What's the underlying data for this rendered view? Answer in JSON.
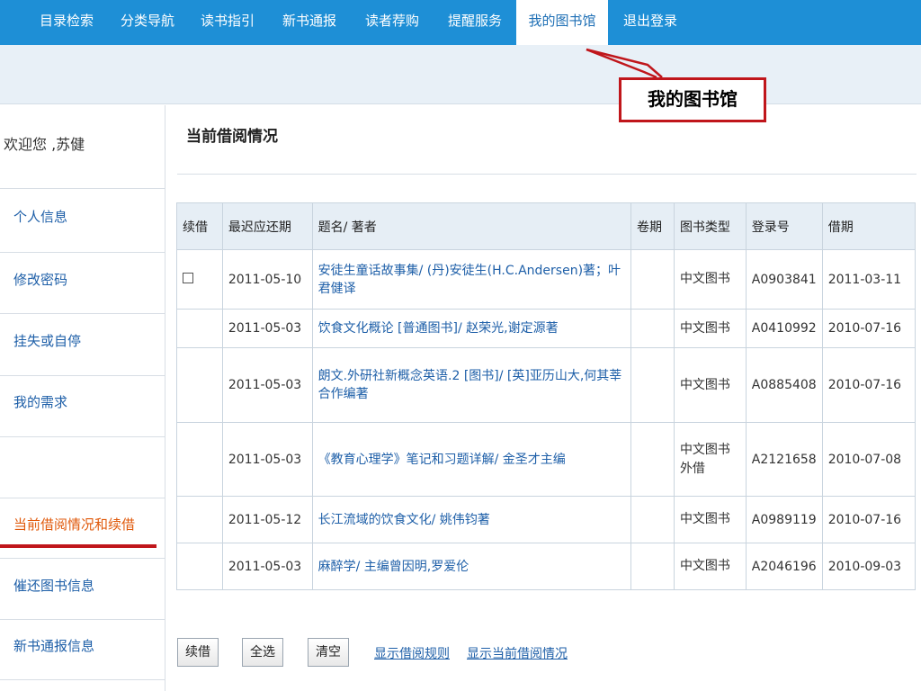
{
  "nav": {
    "items": [
      {
        "label": "目录检索"
      },
      {
        "label": "分类导航"
      },
      {
        "label": "读书指引"
      },
      {
        "label": "新书通报"
      },
      {
        "label": "读者荐购"
      },
      {
        "label": "提醒服务"
      },
      {
        "label": "我的图书馆"
      },
      {
        "label": "退出登录"
      }
    ],
    "active_index": 6
  },
  "callout": {
    "text": "我的图书馆"
  },
  "sidebar": {
    "welcome": "欢迎您 ,苏健",
    "items": [
      {
        "label": "个人信息"
      },
      {
        "label": "修改密码"
      },
      {
        "label": "挂失或自停"
      },
      {
        "label": "我的需求"
      },
      {
        "label": "当前借阅情况和续借"
      },
      {
        "label": "催还图书信息"
      },
      {
        "label": "新书通报信息"
      }
    ],
    "active_index": 4
  },
  "main": {
    "title": "当前借阅情况"
  },
  "table": {
    "headers": [
      "续借",
      "最迟应还期",
      "题名/ 著者",
      "卷期",
      "图书类型",
      "登录号",
      "借期"
    ],
    "rows": [
      {
        "renew_checkbox": true,
        "due": "2011-05-10",
        "title": "安徒生童话故事集/ (丹)安徒生(H.C.Andersen)著；叶君健译",
        "volume": "",
        "type": "中文图书",
        "reg_no": "A0903841",
        "borrow_date": "2011-03-11"
      },
      {
        "renew_checkbox": false,
        "due": "2011-05-03",
        "title": "饮食文化概论 [普通图书]/ 赵荣光,谢定源著",
        "volume": "",
        "type": "中文图书",
        "reg_no": "A0410992",
        "borrow_date": "2010-07-16"
      },
      {
        "renew_checkbox": false,
        "due": "2011-05-03",
        "title": "朗文.外研社新概念英语.2 [图书]/ [英]亚历山大,何其莘合作编著",
        "volume": "",
        "type": "中文图书",
        "reg_no": "A0885408",
        "borrow_date": "2010-07-16"
      },
      {
        "renew_checkbox": false,
        "due": "2011-05-03",
        "title": "《教育心理学》笔记和习题详解/ 金圣才主编",
        "volume": "",
        "type": "中文图书外借",
        "reg_no": "A2121658",
        "borrow_date": "2010-07-08"
      },
      {
        "renew_checkbox": false,
        "due": "2011-05-12",
        "title": "长江流域的饮食文化/ 姚伟钧著",
        "volume": "",
        "type": "中文图书",
        "reg_no": "A0989119",
        "borrow_date": "2010-07-16"
      },
      {
        "renew_checkbox": false,
        "due": "2011-05-03",
        "title": "麻醉学/ 主编曾因明,罗爱伦",
        "volume": "",
        "type": "中文图书",
        "reg_no": "A2046196",
        "borrow_date": "2010-09-03"
      }
    ]
  },
  "actions": {
    "renew_label": "续借",
    "select_all_label": "全选",
    "clear_label": "清空",
    "show_rules_label": "显示借阅规则",
    "show_current_label": "显示当前借阅情况"
  },
  "colors": {
    "nav_bg": "#1e8fd6",
    "accent_red": "#c0161b",
    "link_blue": "#1e5fa8",
    "active_orange": "#e05a0c"
  }
}
